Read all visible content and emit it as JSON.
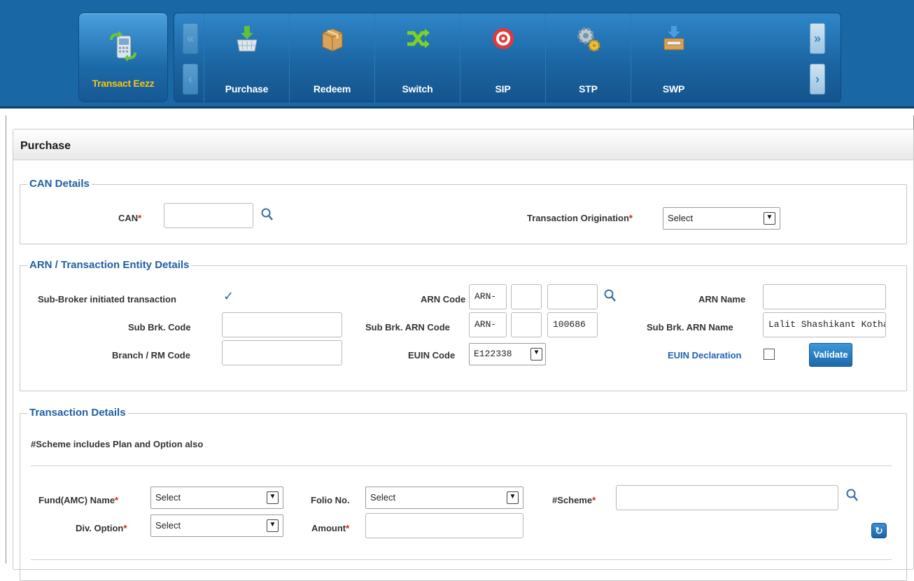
{
  "nav": {
    "home_label": "Transact Eezz",
    "items": [
      {
        "label": "Purchase",
        "icon": "basket-icon"
      },
      {
        "label": "Redeem",
        "icon": "box-icon"
      },
      {
        "label": "Switch",
        "icon": "shuffle-icon"
      },
      {
        "label": "SIP",
        "icon": "target-icon"
      },
      {
        "label": "STP",
        "icon": "gears-icon"
      },
      {
        "label": "SWP",
        "icon": "tray-icon"
      }
    ],
    "first_arrow": "«",
    "prev_arrow": "‹",
    "next_page_arrow": "»",
    "next_arrow": "›"
  },
  "panel": {
    "title": "Purchase"
  },
  "can": {
    "legend": "CAN Details",
    "can_label": "CAN",
    "can_value": "",
    "origination_label": "Transaction Origination",
    "origination_value": "Select"
  },
  "arn": {
    "legend": "ARN / Transaction Entity Details",
    "subbroker_label": "Sub-Broker initiated transaction",
    "subbroker_checked": true,
    "sub_brk_code_label": "Sub Brk. Code",
    "sub_brk_code_value": "",
    "branch_rm_label": "Branch / RM Code",
    "branch_rm_value": "",
    "arn_code_label": "ARN Code",
    "arn_code_prefix": "ARN-",
    "arn_code_part2": "",
    "arn_code_part3": "",
    "sub_brk_arn_code_label": "Sub Brk. ARN Code",
    "sub_brk_arn_prefix": "ARN-",
    "sub_brk_arn_part2": "",
    "sub_brk_arn_part3": "100686",
    "euin_code_label": "EUIN Code",
    "euin_code_value": "E122338",
    "arn_name_label": "ARN Name",
    "arn_name_value": "",
    "sub_brk_arn_name_label": "Sub Brk. ARN Name",
    "sub_brk_arn_name_value": "Lalit Shashikant Kothav",
    "euin_declaration_label": "EUIN Declaration",
    "euin_declaration_checked": false,
    "validate_label": "Validate"
  },
  "txn": {
    "legend": "Transaction Details",
    "note": "#Scheme includes Plan and Option also",
    "fund_label": "Fund(AMC) Name",
    "fund_value": "Select",
    "folio_label": "Folio No.",
    "folio_value": "Select",
    "scheme_label": "#Scheme",
    "scheme_value": "",
    "div_label": "Div. Option",
    "div_value": "Select",
    "amount_label": "Amount",
    "amount_value": ""
  },
  "colors": {
    "accent": "#1f6fb0",
    "home_label": "#f4c518",
    "legend": "#1f5fa4",
    "required": "#d11b1b"
  }
}
